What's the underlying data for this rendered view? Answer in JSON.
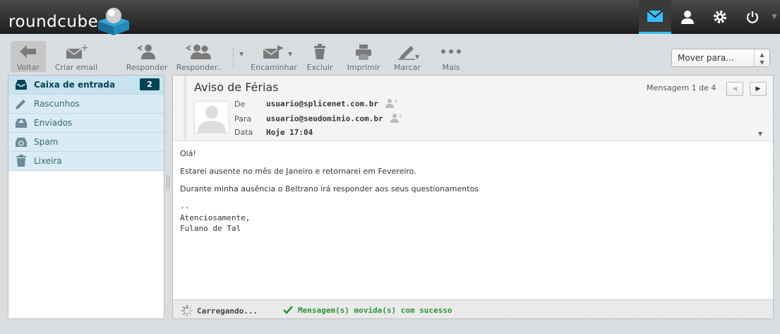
{
  "app": {
    "logo_text": "roundcube"
  },
  "topnav": {
    "items": [
      "mail-icon",
      "contacts-icon",
      "settings-icon",
      "logout-icon"
    ],
    "accent": "#37beff"
  },
  "toolbar": {
    "voltar": "Voltar",
    "compose": "Criar email",
    "reply": "Responder",
    "reply_all": "Responder..",
    "forward": "Encaminhar",
    "delete": "Excluir",
    "print": "Imprimir",
    "mark": "Marcar",
    "more": "Mais",
    "move_select": "Mover para..."
  },
  "folders": [
    {
      "name": "Caixa de entrada",
      "count": "2",
      "icon": "inbox-icon",
      "selected": true
    },
    {
      "name": "Rascunhos",
      "icon": "pencil-icon"
    },
    {
      "name": "Enviados",
      "icon": "sent-icon"
    },
    {
      "name": "Spam",
      "icon": "spam-icon"
    },
    {
      "name": "Lixeira",
      "icon": "trash-icon"
    }
  ],
  "message": {
    "subject": "Aviso de Férias",
    "counter": "Mensagem 1 de 4",
    "from_label": "De",
    "from": "usuario@splicenet.com.br",
    "to_label": "Para",
    "to": "usuario@seudominio.com.br",
    "date_label": "Data",
    "date": "Hoje 17:04",
    "body": [
      "Olá!",
      "Estarei ausente no mês de Janeiro e retornarei em Fevereiro.",
      "Durante minha ausência o Beltrano irá responder aos seus questionamentos"
    ],
    "signature": "--\nAtenciosamente,\nFulano de Tal"
  },
  "status": {
    "loading": "Carregando...",
    "success": "Mensagem(s) movida(s) com sucesso"
  }
}
